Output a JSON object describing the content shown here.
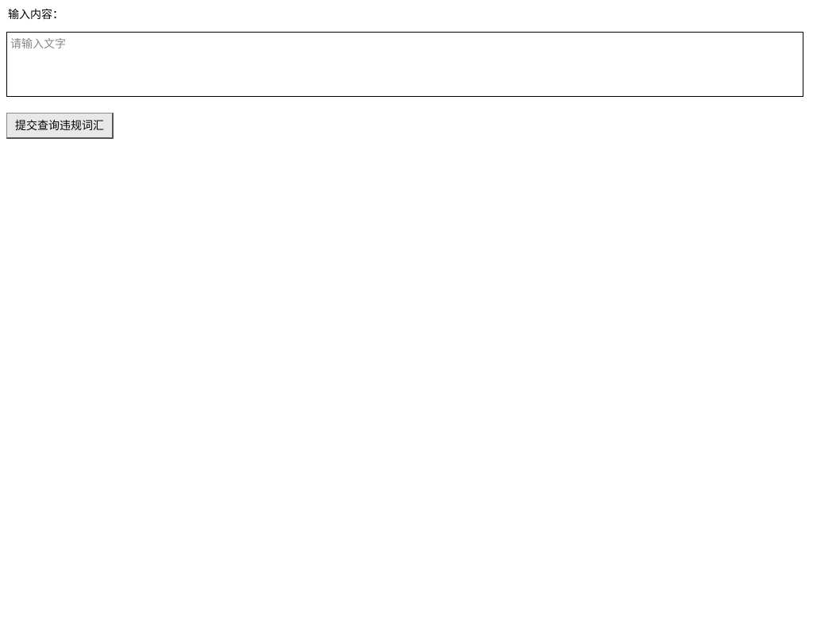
{
  "form": {
    "label": "输入内容：",
    "textarea_placeholder": "请输入文字",
    "textarea_value": "",
    "submit_label": "提交查询违规词汇"
  }
}
